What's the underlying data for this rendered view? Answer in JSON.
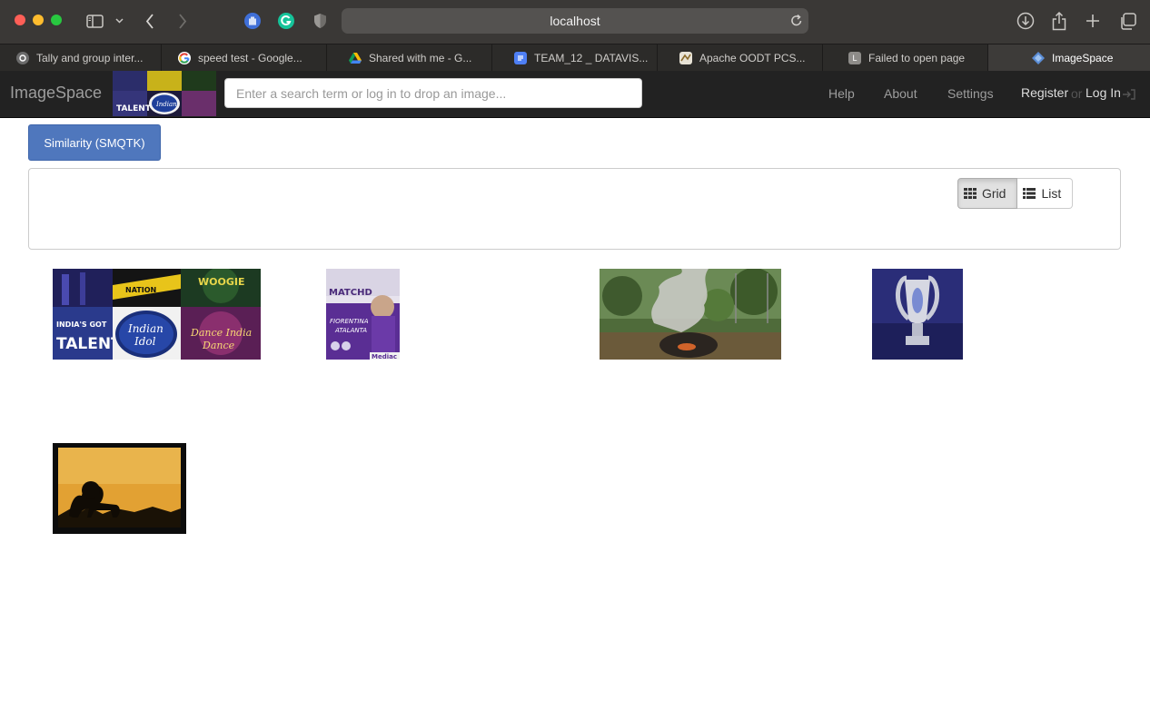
{
  "browser": {
    "url": "localhost",
    "tabs": [
      {
        "label": "Tally and group inter...",
        "favicon": "gear-icon"
      },
      {
        "label": "speed test - Google...",
        "favicon": "google-icon"
      },
      {
        "label": "Shared with me - G...",
        "favicon": "drive-icon"
      },
      {
        "label": "TEAM_12 _ DATAVIS...",
        "favicon": "docs-icon"
      },
      {
        "label": "Apache OODT PCS...",
        "favicon": "oodt-icon"
      },
      {
        "label": "Failed to open page",
        "favicon": "L"
      },
      {
        "label": "ImageSpace",
        "favicon": "imagespace-icon"
      }
    ]
  },
  "navbar": {
    "brand": "ImageSpace",
    "search_placeholder": "Enter a search term or log in to drop an image...",
    "links": {
      "help": "Help",
      "about": "About",
      "settings": "Settings",
      "register": "Register",
      "or": "or",
      "login": "Log In"
    }
  },
  "main": {
    "similarity_button": "Similarity (SMQTK)",
    "view": {
      "grid": "Grid",
      "list": "List",
      "selected": "Grid"
    },
    "results": [
      {
        "subject": "tv-talent-shows-collage"
      },
      {
        "subject": "matchday-fiorentina-atalanta"
      },
      {
        "subject": "smoke-fire-garden"
      },
      {
        "subject": "champions-league-trophy"
      },
      {
        "subject": "lion-silhouette-sunset"
      }
    ]
  },
  "colors": {
    "navbar": "#222222",
    "primary_button": "#4f77bd",
    "chrome": "#3a3836"
  }
}
